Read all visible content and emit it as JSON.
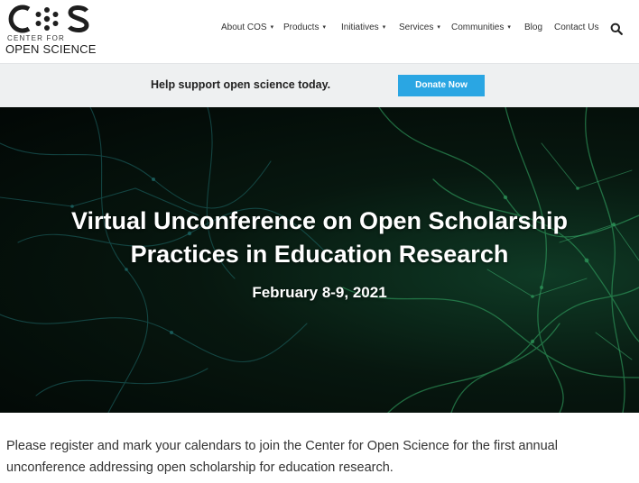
{
  "logo": {
    "mark": "COS",
    "subtitle": "CENTER FOR",
    "name": "OPEN SCIENCE"
  },
  "nav": {
    "items": [
      {
        "label": "About COS",
        "dropdown": true
      },
      {
        "label": "Products",
        "dropdown": true
      },
      {
        "label": "Initiatives",
        "dropdown": true
      },
      {
        "label": "Services",
        "dropdown": true
      },
      {
        "label": "Communities",
        "dropdown": true
      },
      {
        "label": "Blog",
        "dropdown": false
      },
      {
        "label": "Contact Us",
        "dropdown": false
      }
    ],
    "search_icon": "search-icon",
    "caret": "▾"
  },
  "donate": {
    "text": "Help support open science today.",
    "button_label": "Donate Now",
    "button_color": "#2aa6e3"
  },
  "hero": {
    "title_line1": "Virtual Unconference on Open Scholarship",
    "title_line2": "Practices in Education Research",
    "date": "February 8-9, 2021"
  },
  "intro": {
    "text": "Please register and mark your calendars to join the Center for Open Science for the first annual unconference addressing open scholarship for education research."
  }
}
